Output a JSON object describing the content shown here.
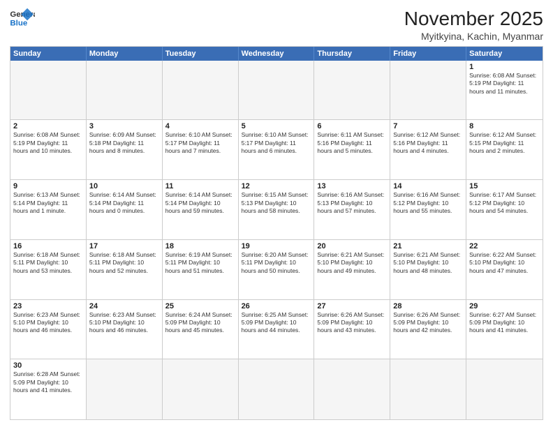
{
  "header": {
    "logo_general": "General",
    "logo_blue": "Blue",
    "title": "November 2025",
    "subtitle": "Myitkyina, Kachin, Myanmar"
  },
  "days_of_week": [
    "Sunday",
    "Monday",
    "Tuesday",
    "Wednesday",
    "Thursday",
    "Friday",
    "Saturday"
  ],
  "weeks": [
    [
      {
        "day": "",
        "text": "",
        "empty": true
      },
      {
        "day": "",
        "text": "",
        "empty": true
      },
      {
        "day": "",
        "text": "",
        "empty": true
      },
      {
        "day": "",
        "text": "",
        "empty": true
      },
      {
        "day": "",
        "text": "",
        "empty": true
      },
      {
        "day": "",
        "text": "",
        "empty": true
      },
      {
        "day": "1",
        "text": "Sunrise: 6:08 AM\nSunset: 5:19 PM\nDaylight: 11 hours and 11 minutes.",
        "empty": false
      }
    ],
    [
      {
        "day": "2",
        "text": "Sunrise: 6:08 AM\nSunset: 5:19 PM\nDaylight: 11 hours and 10 minutes.",
        "empty": false
      },
      {
        "day": "3",
        "text": "Sunrise: 6:09 AM\nSunset: 5:18 PM\nDaylight: 11 hours and 8 minutes.",
        "empty": false
      },
      {
        "day": "4",
        "text": "Sunrise: 6:10 AM\nSunset: 5:17 PM\nDaylight: 11 hours and 7 minutes.",
        "empty": false
      },
      {
        "day": "5",
        "text": "Sunrise: 6:10 AM\nSunset: 5:17 PM\nDaylight: 11 hours and 6 minutes.",
        "empty": false
      },
      {
        "day": "6",
        "text": "Sunrise: 6:11 AM\nSunset: 5:16 PM\nDaylight: 11 hours and 5 minutes.",
        "empty": false
      },
      {
        "day": "7",
        "text": "Sunrise: 6:12 AM\nSunset: 5:16 PM\nDaylight: 11 hours and 4 minutes.",
        "empty": false
      },
      {
        "day": "8",
        "text": "Sunrise: 6:12 AM\nSunset: 5:15 PM\nDaylight: 11 hours and 2 minutes.",
        "empty": false
      }
    ],
    [
      {
        "day": "9",
        "text": "Sunrise: 6:13 AM\nSunset: 5:14 PM\nDaylight: 11 hours and 1 minute.",
        "empty": false
      },
      {
        "day": "10",
        "text": "Sunrise: 6:14 AM\nSunset: 5:14 PM\nDaylight: 11 hours and 0 minutes.",
        "empty": false
      },
      {
        "day": "11",
        "text": "Sunrise: 6:14 AM\nSunset: 5:14 PM\nDaylight: 10 hours and 59 minutes.",
        "empty": false
      },
      {
        "day": "12",
        "text": "Sunrise: 6:15 AM\nSunset: 5:13 PM\nDaylight: 10 hours and 58 minutes.",
        "empty": false
      },
      {
        "day": "13",
        "text": "Sunrise: 6:16 AM\nSunset: 5:13 PM\nDaylight: 10 hours and 57 minutes.",
        "empty": false
      },
      {
        "day": "14",
        "text": "Sunrise: 6:16 AM\nSunset: 5:12 PM\nDaylight: 10 hours and 55 minutes.",
        "empty": false
      },
      {
        "day": "15",
        "text": "Sunrise: 6:17 AM\nSunset: 5:12 PM\nDaylight: 10 hours and 54 minutes.",
        "empty": false
      }
    ],
    [
      {
        "day": "16",
        "text": "Sunrise: 6:18 AM\nSunset: 5:11 PM\nDaylight: 10 hours and 53 minutes.",
        "empty": false
      },
      {
        "day": "17",
        "text": "Sunrise: 6:18 AM\nSunset: 5:11 PM\nDaylight: 10 hours and 52 minutes.",
        "empty": false
      },
      {
        "day": "18",
        "text": "Sunrise: 6:19 AM\nSunset: 5:11 PM\nDaylight: 10 hours and 51 minutes.",
        "empty": false
      },
      {
        "day": "19",
        "text": "Sunrise: 6:20 AM\nSunset: 5:11 PM\nDaylight: 10 hours and 50 minutes.",
        "empty": false
      },
      {
        "day": "20",
        "text": "Sunrise: 6:21 AM\nSunset: 5:10 PM\nDaylight: 10 hours and 49 minutes.",
        "empty": false
      },
      {
        "day": "21",
        "text": "Sunrise: 6:21 AM\nSunset: 5:10 PM\nDaylight: 10 hours and 48 minutes.",
        "empty": false
      },
      {
        "day": "22",
        "text": "Sunrise: 6:22 AM\nSunset: 5:10 PM\nDaylight: 10 hours and 47 minutes.",
        "empty": false
      }
    ],
    [
      {
        "day": "23",
        "text": "Sunrise: 6:23 AM\nSunset: 5:10 PM\nDaylight: 10 hours and 46 minutes.",
        "empty": false
      },
      {
        "day": "24",
        "text": "Sunrise: 6:23 AM\nSunset: 5:10 PM\nDaylight: 10 hours and 46 minutes.",
        "empty": false
      },
      {
        "day": "25",
        "text": "Sunrise: 6:24 AM\nSunset: 5:09 PM\nDaylight: 10 hours and 45 minutes.",
        "empty": false
      },
      {
        "day": "26",
        "text": "Sunrise: 6:25 AM\nSunset: 5:09 PM\nDaylight: 10 hours and 44 minutes.",
        "empty": false
      },
      {
        "day": "27",
        "text": "Sunrise: 6:26 AM\nSunset: 5:09 PM\nDaylight: 10 hours and 43 minutes.",
        "empty": false
      },
      {
        "day": "28",
        "text": "Sunrise: 6:26 AM\nSunset: 5:09 PM\nDaylight: 10 hours and 42 minutes.",
        "empty": false
      },
      {
        "day": "29",
        "text": "Sunrise: 6:27 AM\nSunset: 5:09 PM\nDaylight: 10 hours and 41 minutes.",
        "empty": false
      }
    ],
    [
      {
        "day": "30",
        "text": "Sunrise: 6:28 AM\nSunset: 5:09 PM\nDaylight: 10 hours and 41 minutes.",
        "empty": false
      },
      {
        "day": "",
        "text": "",
        "empty": true
      },
      {
        "day": "",
        "text": "",
        "empty": true
      },
      {
        "day": "",
        "text": "",
        "empty": true
      },
      {
        "day": "",
        "text": "",
        "empty": true
      },
      {
        "day": "",
        "text": "",
        "empty": true
      },
      {
        "day": "",
        "text": "",
        "empty": true
      }
    ]
  ]
}
